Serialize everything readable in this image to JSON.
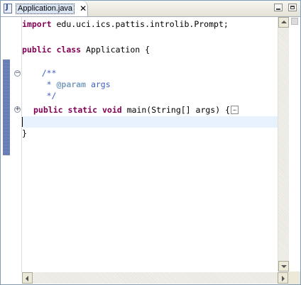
{
  "editor": {
    "tab": {
      "title": "Application.java",
      "close_glyph": "✕",
      "icon": "java-file-icon"
    },
    "window_buttons": {
      "minimize": "minimize-icon",
      "maximize": "maximize-icon"
    }
  },
  "code": {
    "line1": {
      "kw": "import",
      "rest": " edu.uci.ics.pattis.introlib.Prompt;"
    },
    "line3": {
      "kw1": "public",
      "kw2": "class",
      "rest": " Application {"
    },
    "line5": {
      "text": "    /**"
    },
    "line6": {
      "prefix": "     * ",
      "tag": "@param",
      "rest": " args"
    },
    "line7": {
      "text": "     */"
    },
    "line8": {
      "kw1": "public",
      "kw2": "static",
      "kw3": "void",
      "rest": " main(String[] args) {",
      "folded": "…"
    },
    "line10": {
      "text": "}"
    }
  },
  "gutter": {
    "collapse_glyph": "−",
    "expand_glyph": "+"
  },
  "colors": {
    "keyword": "#7f0055",
    "javadoc": "#3f5fbf",
    "javadoc_tag": "#7f9fbf",
    "current_line": "#e8f2fe"
  }
}
